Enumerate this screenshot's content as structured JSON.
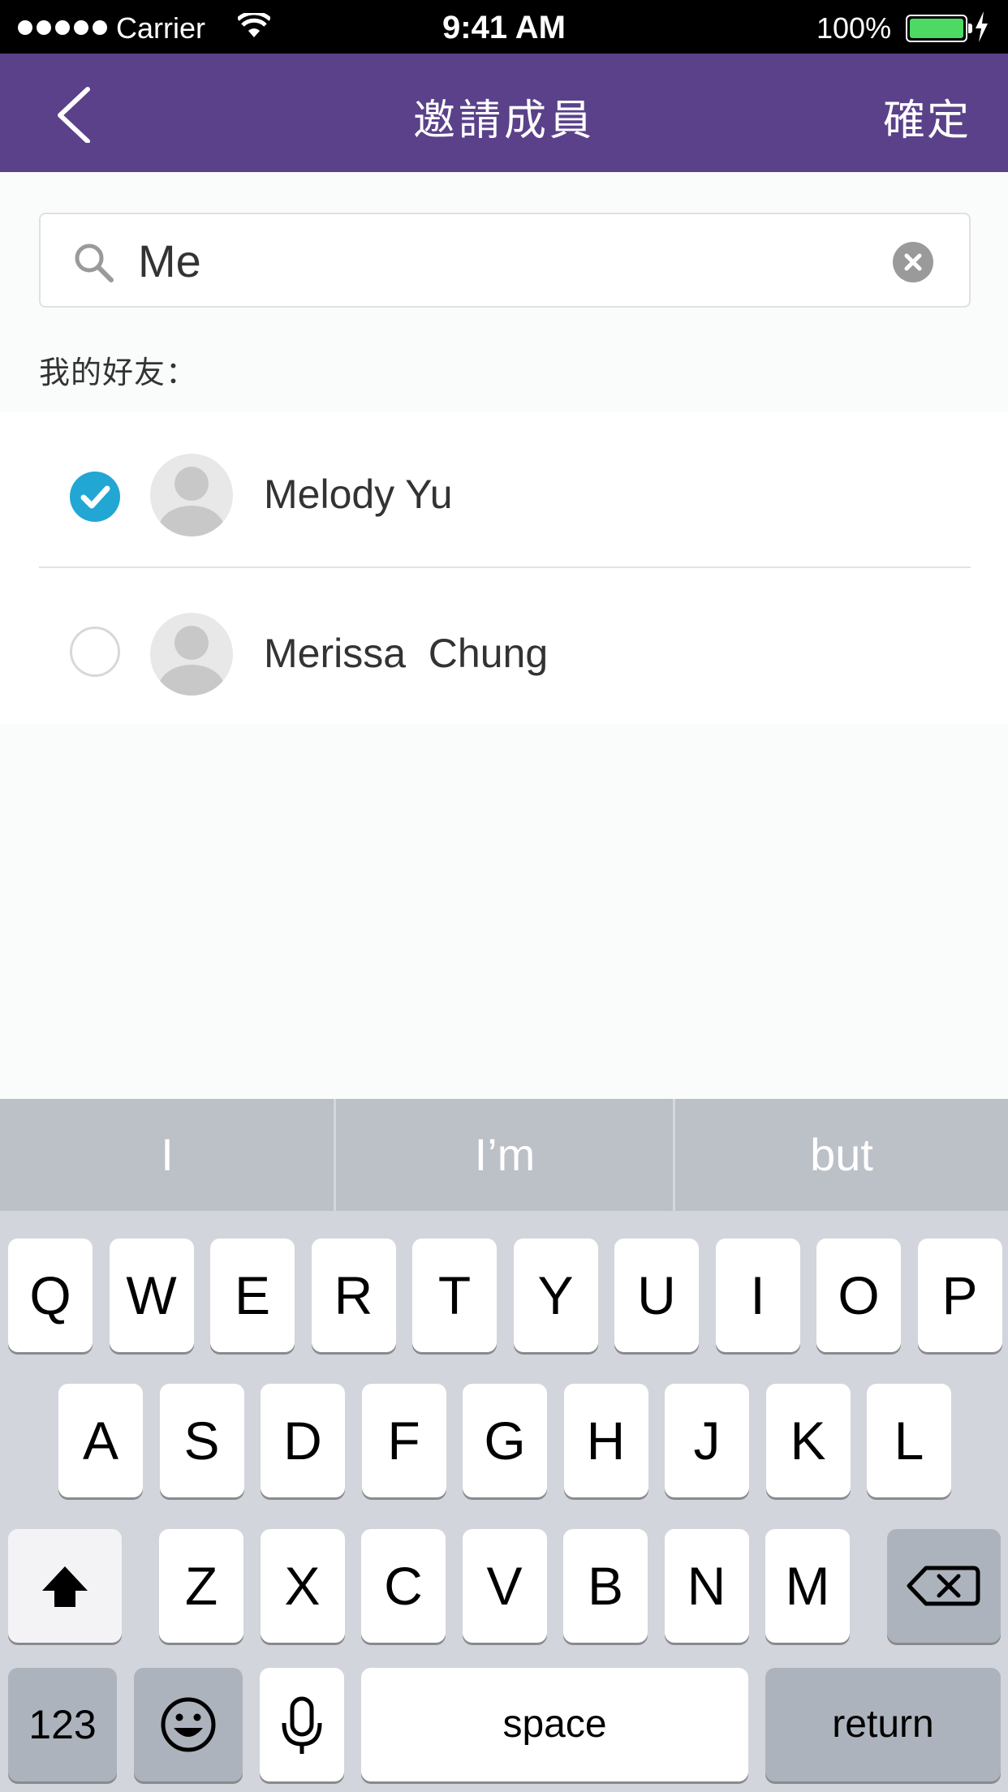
{
  "status_bar": {
    "carrier": "Carrier",
    "time": "9:41 AM",
    "battery": "100%"
  },
  "nav": {
    "title": "邀請成員",
    "confirm": "確定"
  },
  "search": {
    "value": "Me"
  },
  "section_label": "我的好友：",
  "friends": [
    {
      "name": "Melody Yu",
      "selected": true
    },
    {
      "name": "Merissa  Chung",
      "selected": false
    }
  ],
  "keyboard": {
    "suggestions": [
      "I",
      "I’m",
      "but"
    ],
    "row1": [
      "Q",
      "W",
      "E",
      "R",
      "T",
      "Y",
      "U",
      "I",
      "O",
      "P"
    ],
    "row2": [
      "A",
      "S",
      "D",
      "F",
      "G",
      "H",
      "J",
      "K",
      "L"
    ],
    "row3": [
      "Z",
      "X",
      "C",
      "V",
      "B",
      "N",
      "M"
    ],
    "numbers_label": "123",
    "space_label": "space",
    "return_label": "return"
  },
  "colors": {
    "nav_bar": "#5a418a",
    "check_selected": "#22a6d4",
    "battery": "#4cd964"
  },
  "icons": [
    "back-chevron-icon",
    "search-icon",
    "clear-icon",
    "check-icon",
    "avatar-placeholder-icon",
    "shift-icon",
    "backspace-icon",
    "emoji-icon",
    "microphone-icon",
    "wifi-icon",
    "battery-icon",
    "charging-bolt-icon"
  ]
}
